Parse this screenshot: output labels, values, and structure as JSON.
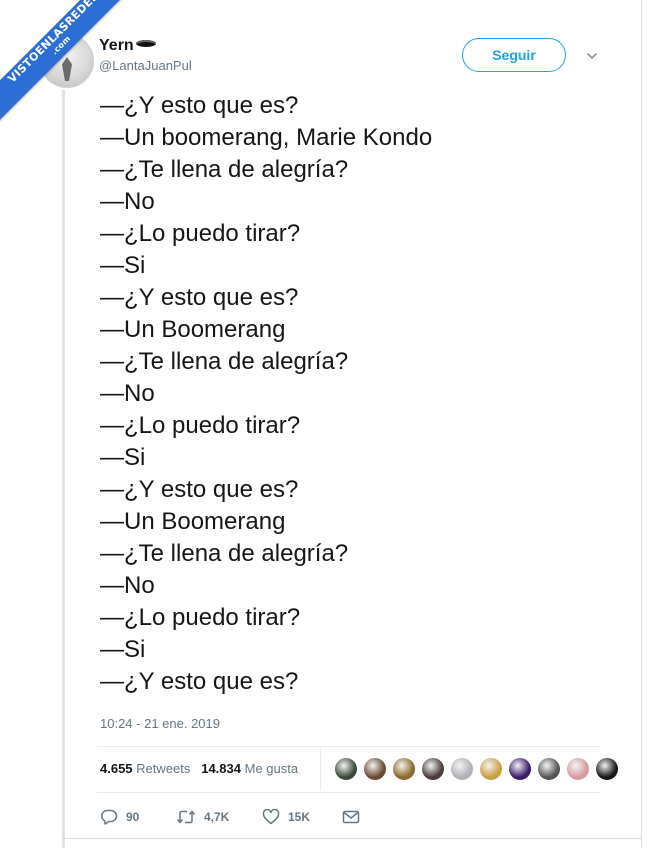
{
  "watermark": {
    "text_top": "VISTOENLASREDES",
    "text_bottom": ".com",
    "color": "#2b6fd6"
  },
  "author": {
    "display_name": "Yern",
    "handle": "@LantaJuanPul",
    "avatar_icon": "avatar-image",
    "name_emoji_icon": "hat-icon"
  },
  "header": {
    "follow_label": "Seguir",
    "menu_icon": "chevron-down-icon"
  },
  "tweet": {
    "lines": [
      "—¿Y esto que es?",
      "—Un boomerang, Marie Kondo",
      "—¿Te llena de alegría?",
      "—No",
      "—¿Lo puedo tirar?",
      "—Si",
      "—¿Y esto que es?",
      "—Un Boomerang",
      "—¿Te llena de alegría?",
      "—No",
      "—¿Lo puedo tirar?",
      "—Si",
      "—¿Y esto que es?",
      "—Un Boomerang",
      "—¿Te llena de alegría?",
      "—No",
      "—¿Lo puedo tirar?",
      "—Si",
      "—¿Y esto que es?"
    ],
    "timestamp": "10:24 - 21 ene. 2019"
  },
  "stats": {
    "retweets_count": "4.655",
    "retweets_label": "Retweets",
    "likes_count": "14.834",
    "likes_label": "Me gusta"
  },
  "likers": [
    {
      "color": "#3a4a3a"
    },
    {
      "color": "#6b4a32"
    },
    {
      "color": "#8a6a2a"
    },
    {
      "color": "#4a3a3a"
    },
    {
      "color": "#b0b0b8"
    },
    {
      "color": "#c8a040"
    },
    {
      "color": "#3a1a6a"
    },
    {
      "color": "#555555"
    },
    {
      "color": "#d89aa0"
    },
    {
      "color": "#151515"
    }
  ],
  "actions": {
    "reply_count": "90",
    "retweet_count": "4,7K",
    "like_count": "15K"
  },
  "colors": {
    "accent": "#1da1f2",
    "text": "#14171a",
    "muted": "#657786"
  }
}
